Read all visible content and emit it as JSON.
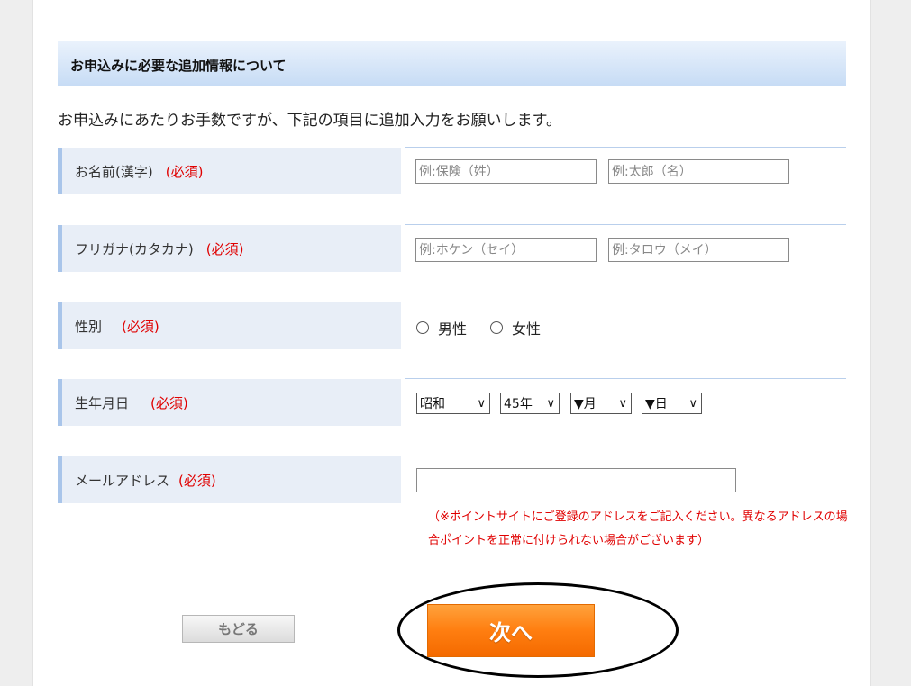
{
  "section_title": "お申込みに必要な追加情報について",
  "intro": "お申込みにあたりお手数ですが、下記の項目に追加入力をお願いします。",
  "required_label": "(必須)",
  "rows": {
    "name_kanji": {
      "label": "お名前(漢字)",
      "last_placeholder": "例:保険（姓）",
      "first_placeholder": "例:太郎（名）"
    },
    "furigana": {
      "label": "フリガナ(カタカナ)",
      "last_placeholder": "例:ホケン（セイ）",
      "first_placeholder": "例:タロウ（メイ）"
    },
    "gender": {
      "label": "性別",
      "options": [
        "男性",
        "女性"
      ]
    },
    "birthdate": {
      "label": "生年月日",
      "era": "昭和",
      "year": "45年",
      "month": "▼月",
      "day": "▼日"
    },
    "email": {
      "label": "メールアドレス",
      "value": "",
      "note": "（※ポイントサイトにご登録のアドレスをご記入ください。異なるアドレスの場合ポイントを正常に付けられない場合がございます）"
    }
  },
  "buttons": {
    "back": "もどる",
    "next": "次へ"
  },
  "icons": {
    "radio": "radio-icon",
    "dropdown": "chevron-down-icon"
  },
  "colors": {
    "required": "#e00000",
    "header_gradient_top": "#eaf2fc",
    "header_gradient_bottom": "#c7dcf5",
    "label_bg": "#e8eef7",
    "label_accent": "#a9c5ea",
    "next_button": "#ff7e10"
  }
}
